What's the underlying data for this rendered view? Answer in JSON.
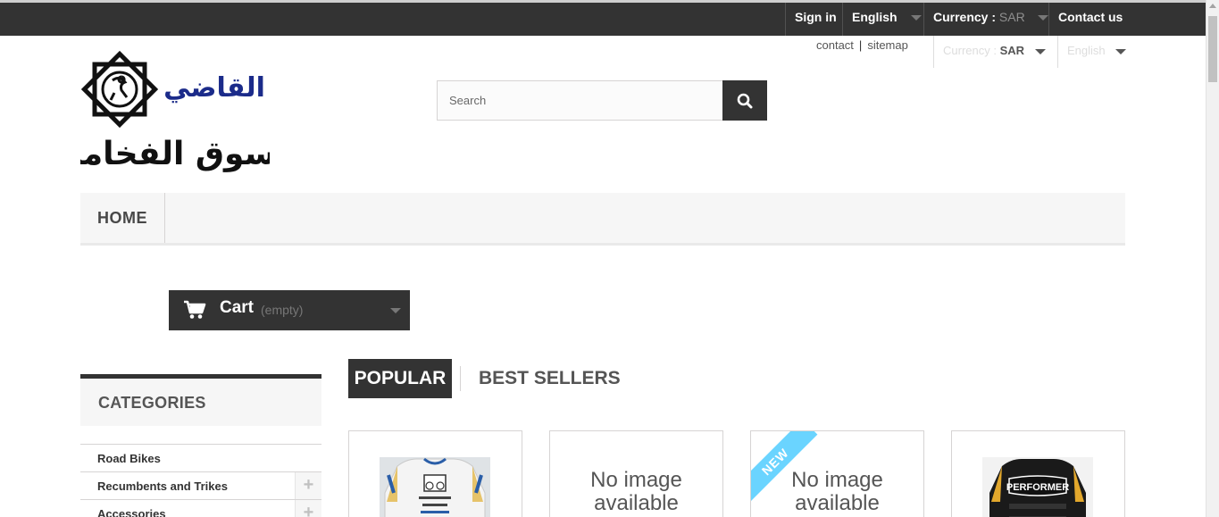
{
  "topbar": {
    "sign_in": "Sign in",
    "language": "English",
    "currency_label": "Currency :",
    "currency_value": "SAR",
    "contact_us": "Contact us"
  },
  "header_links": {
    "contact": "contact",
    "separator": "|",
    "sitemap": "sitemap"
  },
  "header_dropdowns": {
    "currency_label": "Currency :",
    "currency_value": "SAR",
    "language": "English"
  },
  "logo": {
    "line1": "القاضي",
    "line2": "سوق الفخامة"
  },
  "search": {
    "placeholder": "Search",
    "button_icon": "search-icon"
  },
  "menu": {
    "items": [
      {
        "label": "HOME"
      }
    ]
  },
  "cart": {
    "title": "Cart",
    "status": "(empty)",
    "icon": "cart-icon"
  },
  "categories": {
    "title": "CATEGORIES",
    "items": [
      {
        "label": "Road Bikes",
        "expandable": false
      },
      {
        "label": "Recumbents and Trikes",
        "expandable": true
      },
      {
        "label": "Accessories",
        "expandable": true
      }
    ],
    "expand_symbol": "+"
  },
  "tabs": {
    "popular": "POPULAR",
    "best_sellers": "BEST SELLERS"
  },
  "products": {
    "no_image_line1": "No image",
    "no_image_line2": "available",
    "new_badge": "NEW",
    "badge_color": "#6ad4ff",
    "jersey_brand": "PERFORMER"
  },
  "colors": {
    "dark": "#333333",
    "panel": "#f6f6f6",
    "border": "#d6d4d4"
  }
}
